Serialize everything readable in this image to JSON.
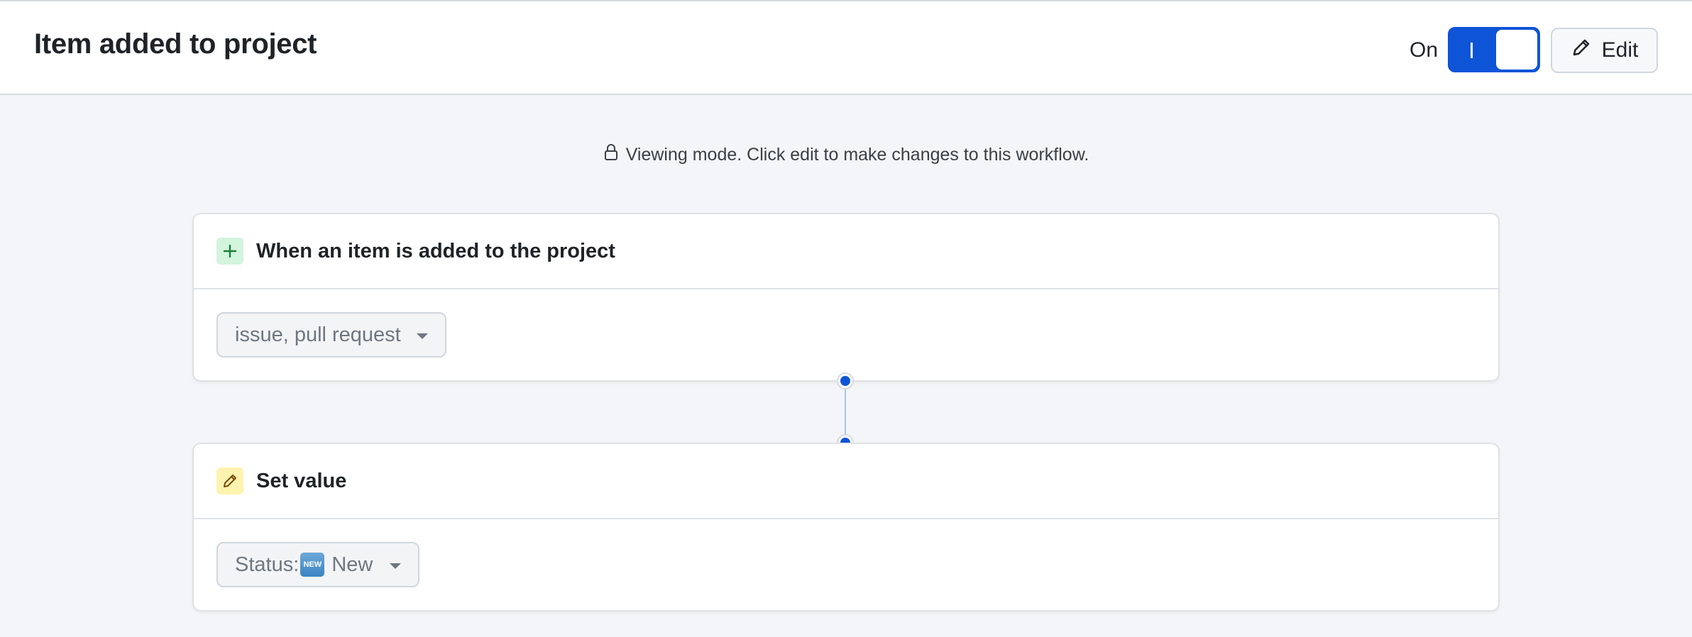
{
  "header": {
    "title": "Item added to project",
    "toggle_label": "On",
    "toggle_on": true,
    "edit_label": "Edit"
  },
  "notice": {
    "text": "Viewing mode. Click edit to make changes to this workflow.",
    "icon": "lock-icon"
  },
  "trigger": {
    "title": "When an item is added to the project",
    "icon": "plus-icon",
    "filter_value": "issue, pull request"
  },
  "action": {
    "title": "Set value",
    "icon": "pencil-icon",
    "value_prefix": "Status:",
    "value_badge": "NEW",
    "value_text": " New"
  },
  "colors": {
    "accent": "#0e54d7",
    "trigger_icon_bg": "#d3f4dd",
    "action_icon_bg": "#fff3b0",
    "canvas_bg": "#f4f5f8"
  }
}
